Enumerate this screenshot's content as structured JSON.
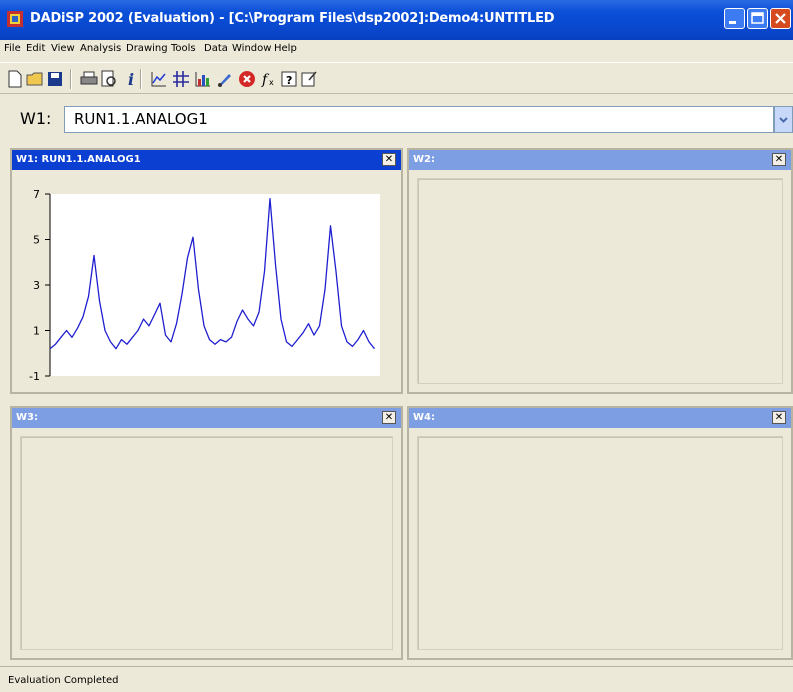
{
  "app": {
    "title": "DADiSP 2002 (Evaluation) - [C:\\Program Files\\dsp2002]:Demo4:UNTITLED"
  },
  "menu": [
    "File",
    "Edit",
    "View",
    "Analysis",
    "Drawing",
    "Tools",
    "Data",
    "Window",
    "Help"
  ],
  "toolbar": {
    "icons": [
      "new-file-icon",
      "open-folder-icon",
      "save-disk-icon",
      "print-icon",
      "print-preview-icon",
      "info-icon",
      "graph-icon",
      "grid-icon",
      "chart-icon",
      "brush-icon",
      "stop-icon",
      "function-icon",
      "help-icon",
      "edit-icon"
    ]
  },
  "command": {
    "label": "W1:",
    "value": "RUN1.1.ANALOG1"
  },
  "windows": [
    {
      "title": "W1: RUN1.1.ANALOG1",
      "close": "✕",
      "active": true
    },
    {
      "title": "W2:",
      "close": "✕",
      "active": false
    },
    {
      "title": "W3:",
      "close": "✕",
      "active": false
    },
    {
      "title": "W4:",
      "close": "✕",
      "active": false
    }
  ],
  "chart_data": {
    "type": "line",
    "title": "",
    "xlabel": "",
    "ylabel": "",
    "xlim": [
      0,
      600
    ],
    "ylim": [
      -1,
      7
    ],
    "xticks": [
      0,
      100,
      200,
      300,
      400,
      500
    ],
    "yticks": [
      -1,
      1,
      3,
      5,
      7
    ],
    "color": "#1f1fd0",
    "series": [
      {
        "x": [
          0,
          10,
          20,
          30,
          40,
          50,
          60,
          70,
          80,
          90,
          100,
          110,
          120,
          130,
          140,
          150,
          160,
          170,
          180,
          190,
          200,
          210,
          220,
          230,
          240,
          250,
          260,
          270,
          280,
          290,
          300,
          310,
          320,
          330,
          340,
          350,
          360,
          370,
          380,
          390,
          400,
          410,
          420,
          430,
          440,
          450,
          460,
          470,
          480,
          490,
          500,
          510,
          520,
          530,
          540,
          550,
          560,
          570,
          580,
          590
        ],
        "y": [
          0.2,
          0.4,
          0.7,
          1.0,
          0.7,
          1.1,
          1.6,
          2.5,
          4.3,
          2.3,
          1.0,
          0.5,
          0.2,
          0.6,
          0.4,
          0.7,
          1.0,
          1.5,
          1.2,
          1.7,
          2.2,
          0.8,
          0.5,
          1.3,
          2.6,
          4.2,
          5.1,
          2.8,
          1.2,
          0.6,
          0.4,
          0.6,
          0.5,
          0.7,
          1.4,
          1.9,
          1.5,
          1.2,
          1.8,
          3.6,
          6.8,
          3.9,
          1.5,
          0.5,
          0.3,
          0.6,
          0.9,
          1.3,
          0.8,
          1.2,
          2.8,
          5.6,
          3.6,
          1.2,
          0.5,
          0.3,
          0.6,
          1.0,
          0.5,
          0.2
        ]
      }
    ]
  },
  "status": {
    "text": "Evaluation Completed"
  }
}
